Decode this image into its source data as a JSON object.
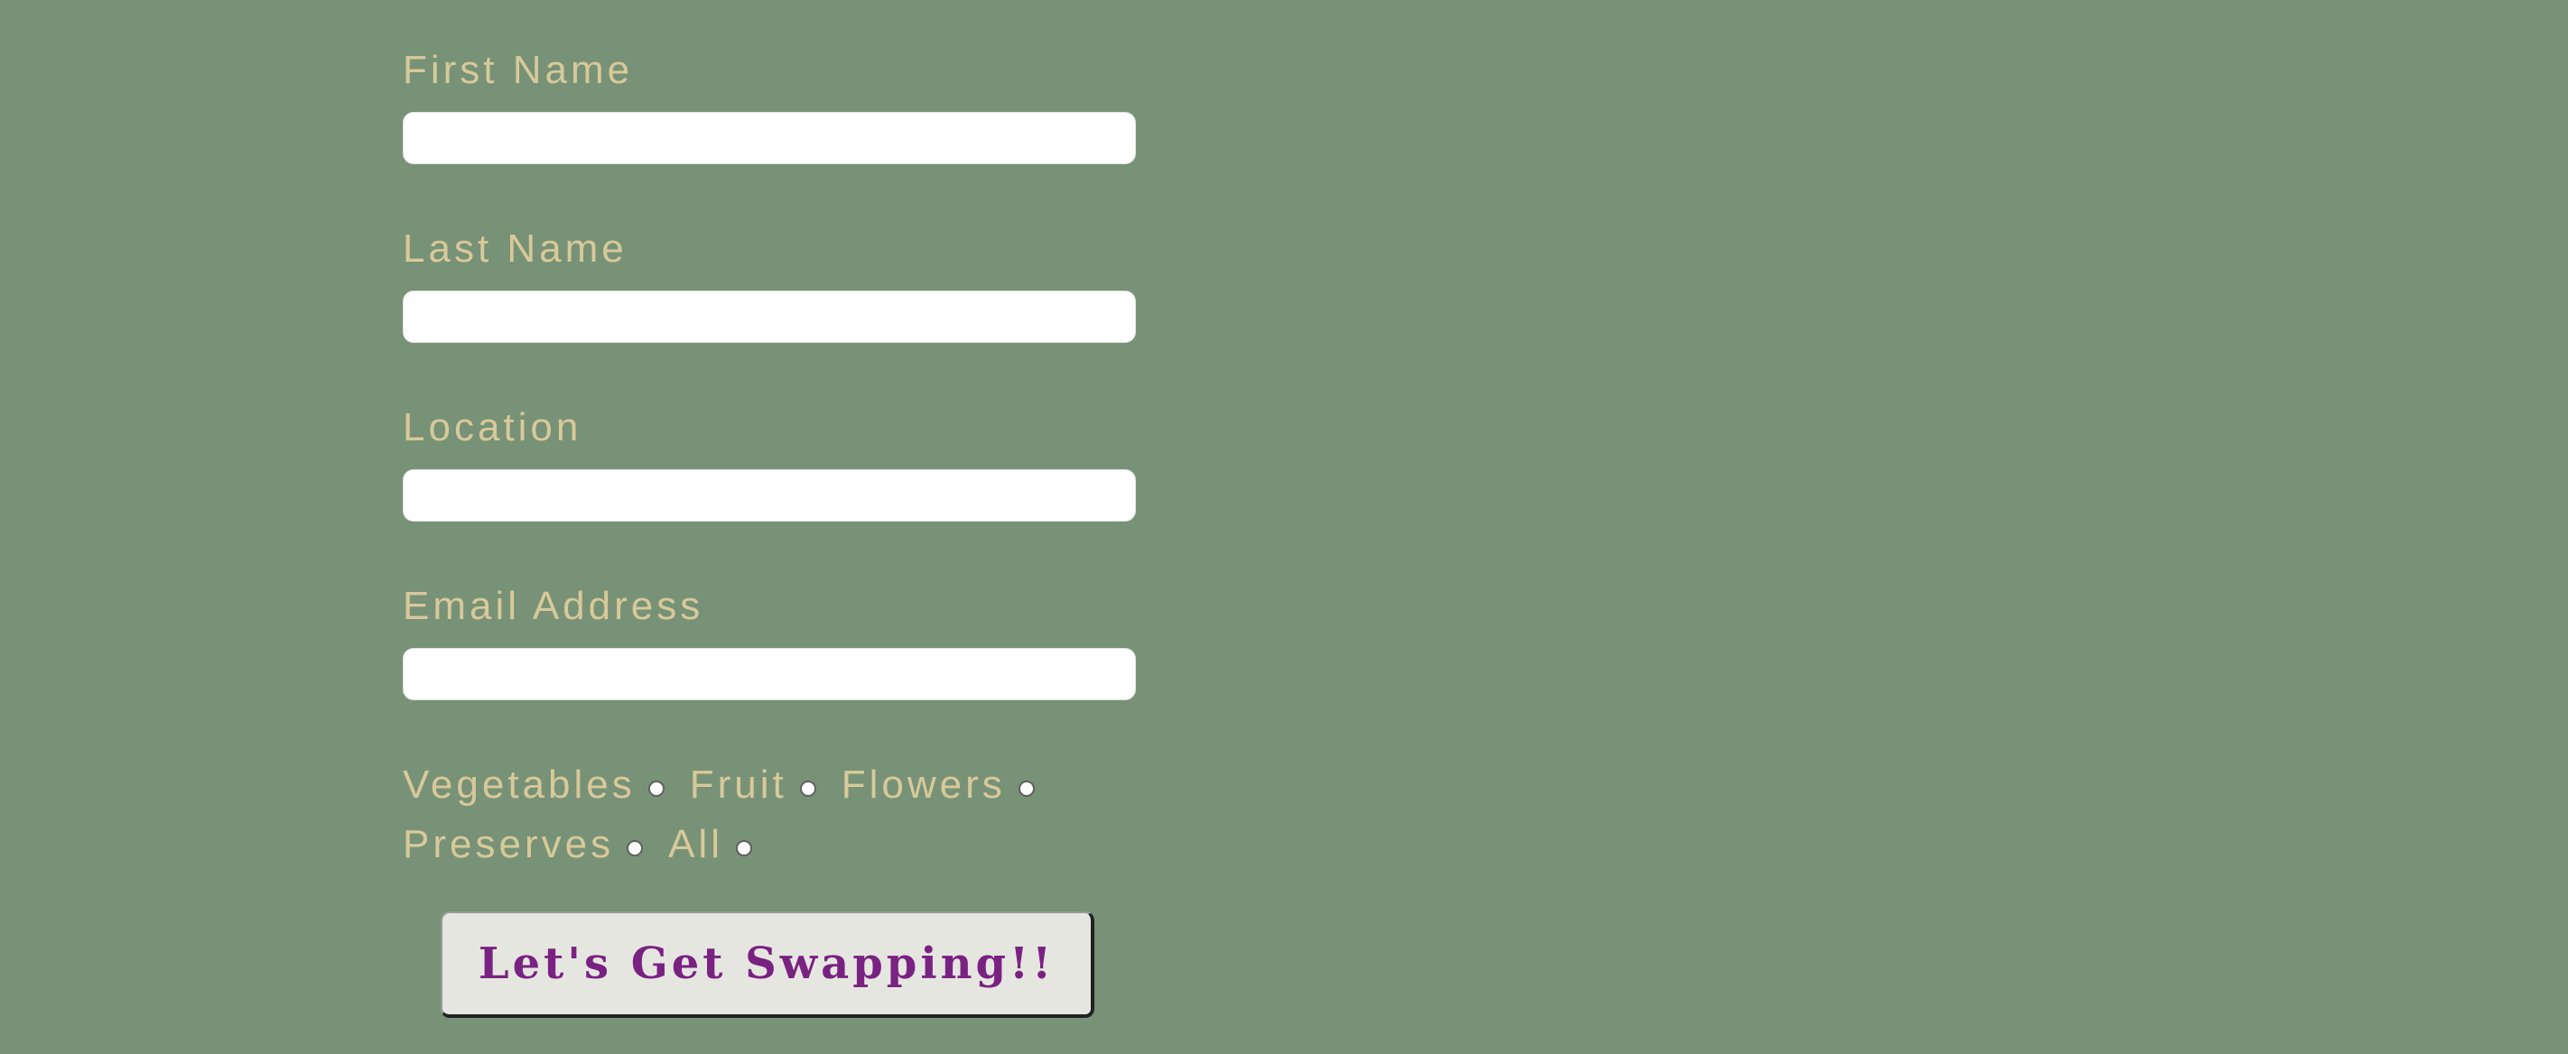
{
  "form": {
    "fields": [
      {
        "label": "First Name",
        "value": "",
        "placeholder": ""
      },
      {
        "label": "Last Name",
        "value": "",
        "placeholder": ""
      },
      {
        "label": "Location",
        "value": "",
        "placeholder": ""
      },
      {
        "label": "Email Address",
        "value": "",
        "placeholder": ""
      }
    ],
    "options": [
      {
        "label": "Vegetables",
        "selected": false
      },
      {
        "label": "Fruit",
        "selected": false
      },
      {
        "label": "Flowers",
        "selected": false
      },
      {
        "label": "Preserves",
        "selected": false
      },
      {
        "label": "All",
        "selected": false
      }
    ],
    "submit_label": "Let's Get Swapping!!"
  },
  "colors": {
    "background": "#779276",
    "label_text": "#d8c99a",
    "button_text": "#7a2282",
    "button_background": "#e6e6e1"
  }
}
